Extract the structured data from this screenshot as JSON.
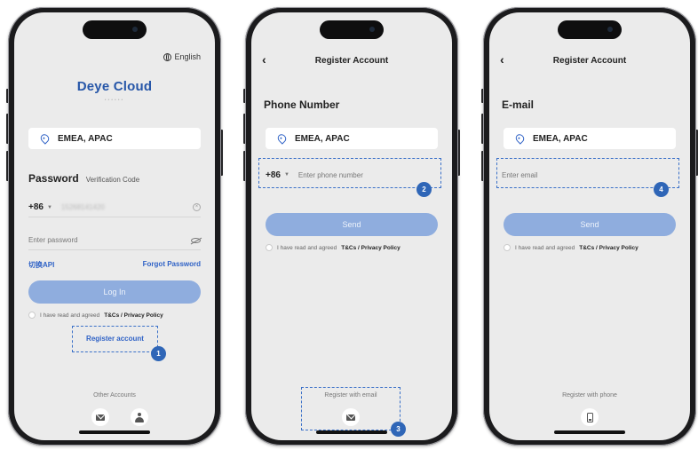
{
  "colors": {
    "accent": "#2f62c6",
    "callout": "#3a70c8",
    "button_disabled": "#8fadde",
    "screen_bg": "#ebebeb"
  },
  "login": {
    "language": "English",
    "logo_text": "Deye Cloud",
    "region": "EMEA, APAC",
    "tab_active": "Password",
    "tab_inactive": "Verification Code",
    "country_code": "+86",
    "phone_masked": "15268141420",
    "password_placeholder": "Enter password",
    "switch_api": "切换API",
    "forgot_password": "Forgot Password",
    "login_button": "Log In",
    "agree_prefix": "I have read and agreed",
    "agree_link": "T&Cs / Privacy Policy",
    "register_link": "Register account",
    "other_accounts": "Other Accounts",
    "icons": [
      "mail-icon",
      "person-icon"
    ]
  },
  "register_phone": {
    "title": "Register Account",
    "section": "Phone Number",
    "region": "EMEA, APAC",
    "country_code": "+86",
    "phone_placeholder": "Enter phone number",
    "send_button": "Send",
    "agree_prefix": "I have read and agreed",
    "agree_link": "T&Cs / Privacy Policy",
    "alt_register": "Register with email"
  },
  "register_email": {
    "title": "Register Account",
    "section": "E-mail",
    "region": "EMEA, APAC",
    "email_placeholder": "Enter email",
    "send_button": "Send",
    "agree_prefix": "I have read and agreed",
    "agree_link": "T&Cs / Privacy Policy",
    "alt_register": "Register with phone"
  },
  "steps": [
    "1",
    "2",
    "3",
    "4"
  ]
}
